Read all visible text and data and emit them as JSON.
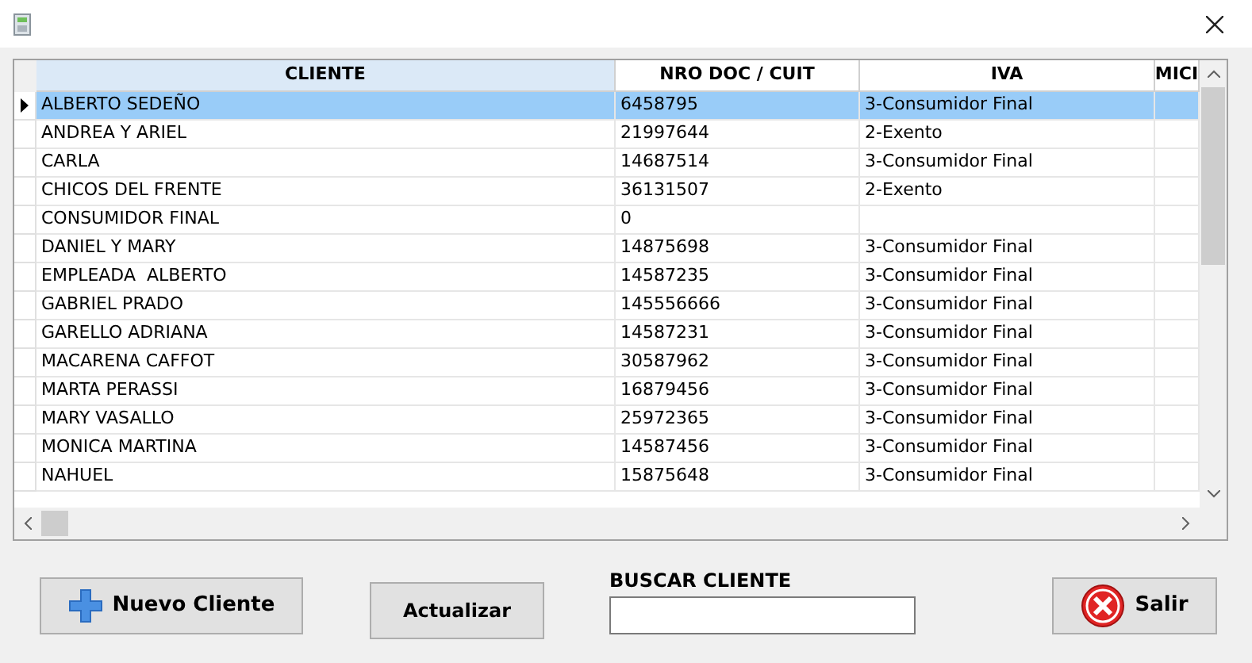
{
  "table": {
    "columns": [
      "CLIENTE",
      "NRO DOC / CUIT",
      "IVA",
      "MICI"
    ],
    "rows": [
      {
        "cells": [
          "ALBERTO SEDEÑO",
          "6458795",
          "3-Consumidor Final"
        ],
        "selected": true
      },
      {
        "cells": [
          "ANDREA Y ARIEL",
          "21997644",
          "2-Exento"
        ],
        "selected": false
      },
      {
        "cells": [
          "CARLA",
          "14687514",
          "3-Consumidor Final"
        ],
        "selected": false
      },
      {
        "cells": [
          "CHICOS DEL FRENTE",
          "36131507",
          "2-Exento"
        ],
        "selected": false
      },
      {
        "cells": [
          "CONSUMIDOR FINAL",
          "0",
          ""
        ],
        "selected": false
      },
      {
        "cells": [
          "DANIEL Y MARY",
          "14875698",
          "3-Consumidor Final"
        ],
        "selected": false
      },
      {
        "cells": [
          "EMPLEADA  ALBERTO",
          "14587235",
          "3-Consumidor Final"
        ],
        "selected": false
      },
      {
        "cells": [
          "GABRIEL PRADO",
          "145556666",
          "3-Consumidor Final"
        ],
        "selected": false
      },
      {
        "cells": [
          "GARELLO ADRIANA",
          "14587231",
          "3-Consumidor Final"
        ],
        "selected": false
      },
      {
        "cells": [
          "MACARENA CAFFOT",
          "30587962",
          "3-Consumidor Final"
        ],
        "selected": false
      },
      {
        "cells": [
          "MARTA PERASSI",
          "16879456",
          "3-Consumidor Final"
        ],
        "selected": false
      },
      {
        "cells": [
          "MARY VASALLO",
          "25972365",
          "3-Consumidor Final"
        ],
        "selected": false
      },
      {
        "cells": [
          "MONICA MARTINA",
          "14587456",
          "3-Consumidor Final"
        ],
        "selected": false
      },
      {
        "cells": [
          "NAHUEL",
          "15875648",
          "3-Consumidor Final"
        ],
        "selected": false
      }
    ]
  },
  "buttons": {
    "new": "Nuevo Cliente",
    "refresh": "Actualizar",
    "exit": "Salir"
  },
  "search": {
    "label": "BUSCAR CLIENTE"
  }
}
